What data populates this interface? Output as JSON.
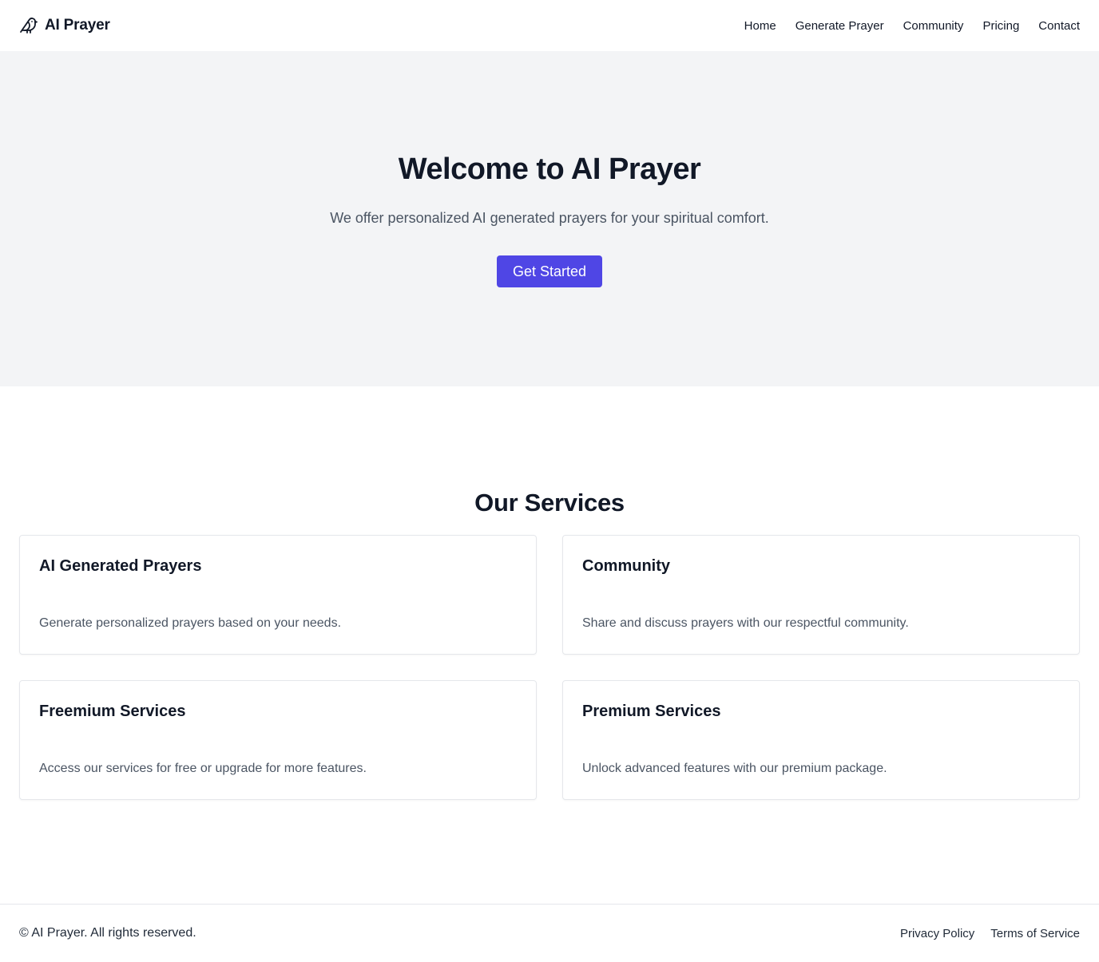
{
  "brand": {
    "icon": "bird-icon",
    "name": "AI Prayer"
  },
  "nav": {
    "items": [
      {
        "label": "Home"
      },
      {
        "label": "Generate Prayer"
      },
      {
        "label": "Community"
      },
      {
        "label": "Pricing"
      },
      {
        "label": "Contact"
      }
    ]
  },
  "hero": {
    "title": "Welcome to AI Prayer",
    "subtitle": "We offer personalized AI generated prayers for your spiritual comfort.",
    "cta_label": "Get Started"
  },
  "services": {
    "title": "Our Services",
    "cards": [
      {
        "title": "AI Generated Prayers",
        "text": "Generate personalized prayers based on your needs."
      },
      {
        "title": "Community",
        "text": "Share and discuss prayers with our respectful community."
      },
      {
        "title": "Freemium Services",
        "text": "Access our services for free or upgrade for more features."
      },
      {
        "title": "Premium Services",
        "text": "Unlock advanced features with our premium package."
      }
    ]
  },
  "footer": {
    "copyright": "© AI Prayer. All rights reserved.",
    "links": [
      {
        "label": "Privacy Policy"
      },
      {
        "label": "Terms of Service"
      }
    ]
  },
  "colors": {
    "accent": "#4f46e5",
    "hero_bg": "#f3f4f6",
    "text": "#111827",
    "muted": "#4b5563",
    "border": "#e5e7eb"
  }
}
